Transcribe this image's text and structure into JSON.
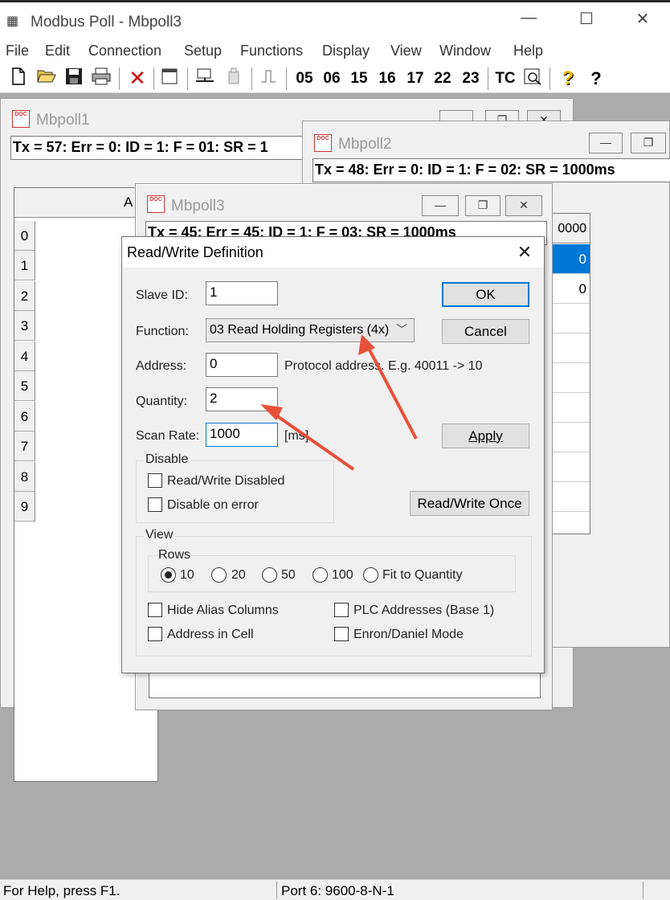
{
  "app": {
    "title": "Modbus Poll - Mbpoll3",
    "minimize": "—",
    "maximize": "☐",
    "close": "✕"
  },
  "menu": [
    "File",
    "Edit",
    "Connection",
    "Setup",
    "Functions",
    "Display",
    "View",
    "Window",
    "Help"
  ],
  "toolbar": {
    "fc": [
      "05",
      "06",
      "15",
      "16",
      "17",
      "22",
      "23"
    ],
    "tc": "TC",
    "help": "?",
    "whatsthis": "?"
  },
  "mbpoll1": {
    "title": "Mbpoll1",
    "status": "Tx = 57: Err = 0: ID = 1: F = 01: SR = 1",
    "col_header": "A",
    "rows": [
      "0",
      "1",
      "2",
      "3",
      "4",
      "5",
      "6",
      "7",
      "8",
      "9"
    ]
  },
  "mbpoll2": {
    "title": "Mbpoll2",
    "status": "Tx = 48: Err = 0: ID = 1: F = 02: SR = 1000ms",
    "col_header": "0000",
    "values": [
      "0",
      "0"
    ]
  },
  "mbpoll3": {
    "title": "Mbpoll3",
    "status": "Tx = 45: Err = 45: ID = 1: F = 03: SR = 1000ms"
  },
  "dialog": {
    "title": "Read/Write Definition",
    "slave_id_label": "Slave ID:",
    "slave_id": "1",
    "function_label": "Function:",
    "function": "03 Read Holding Registers (4x)",
    "address_label": "Address:",
    "address": "0",
    "address_hint": "Protocol address. E.g. 40011 -> 10",
    "quantity_label": "Quantity:",
    "quantity": "2",
    "scan_rate_label": "Scan Rate:",
    "scan_rate": "1000",
    "scan_unit": "[ms]",
    "ok": "OK",
    "cancel": "Cancel",
    "apply": "Apply",
    "rw_once": "Read/Write Once",
    "disable_group": "Disable",
    "rw_disabled": "Read/Write Disabled",
    "disable_on_error": "Disable on error",
    "view_group": "View",
    "rows_group": "Rows",
    "rows_options": [
      "10",
      "20",
      "50",
      "100",
      "Fit to Quantity"
    ],
    "rows_selected": "10",
    "hide_alias": "Hide Alias Columns",
    "plc_addresses": "PLC Addresses (Base 1)",
    "address_in_cell": "Address in Cell",
    "enron_mode": "Enron/Daniel Mode"
  },
  "statusbar": {
    "help": "For Help, press F1.",
    "port": "Port 6: 9600-8-N-1"
  },
  "colors": {
    "mdi_bg": "#ababab",
    "selection": "#0078d7",
    "arrow": "#e8503a"
  }
}
